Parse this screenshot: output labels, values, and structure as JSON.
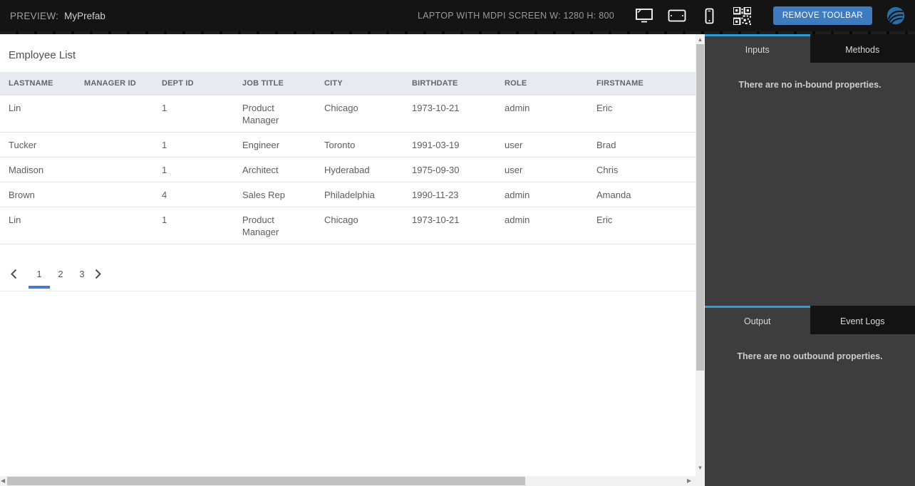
{
  "toolbar": {
    "preview_label": "PREVIEW:",
    "prefab_name": "MyPrefab",
    "device_label": "LAPTOP WITH MDPI SCREEN W: 1280 H: 800",
    "remove_toolbar_label": "REMOVE TOOLBAR",
    "button_color": "#3e7cbf",
    "background": "#141414",
    "icons": {
      "laptop": "laptop-screen-icon",
      "tablet": "tablet-landscape-icon",
      "phone": "phone-portrait-icon",
      "qr": "qr-code-icon",
      "logo": "wavemaker-logo"
    }
  },
  "preview": {
    "title": "Employee List",
    "table": {
      "header_bg": "#e7eaf1",
      "columns": [
        "LASTNAME",
        "MANAGER ID",
        "DEPT ID",
        "JOB TITLE",
        "CITY",
        "BIRTHDATE",
        "ROLE",
        "FIRSTNAME"
      ],
      "rows": [
        [
          "Lin",
          "",
          "1",
          "Product Manager",
          "Chicago",
          "1973-10-21",
          "admin",
          "Eric"
        ],
        [
          "Tucker",
          "",
          "1",
          "Engineer",
          "Toronto",
          "1991-03-19",
          "user",
          "Brad"
        ],
        [
          "Madison",
          "",
          "1",
          "Architect",
          "Hyderabad",
          "1975-09-30",
          "user",
          "Chris"
        ],
        [
          "Brown",
          "",
          "4",
          "Sales Rep",
          "Philadelphia",
          "1990-11-23",
          "admin",
          "Amanda"
        ],
        [
          "Lin",
          "",
          "1",
          "Product Manager",
          "Chicago",
          "1973-10-21",
          "admin",
          "Eric"
        ]
      ]
    },
    "pagination": {
      "pages": [
        "1",
        "2",
        "3"
      ],
      "current_page": "1",
      "active_underline_color": "#4a77d2",
      "prev_icon": "chevron-left-icon",
      "next_icon": "chevron-right-icon"
    }
  },
  "panel": {
    "background": "#3d3d3d",
    "active_tab_indicator_color": "#2d9cdb",
    "properties_group": {
      "tabs": [
        {
          "label": "Inputs",
          "active": true
        },
        {
          "label": "Methods",
          "active": false
        }
      ],
      "message": "There are no in-bound properties."
    },
    "output_group": {
      "tabs": [
        {
          "label": "Output",
          "active": true
        },
        {
          "label": "Event Logs",
          "active": false
        }
      ],
      "message": "There are no outbound properties."
    }
  }
}
